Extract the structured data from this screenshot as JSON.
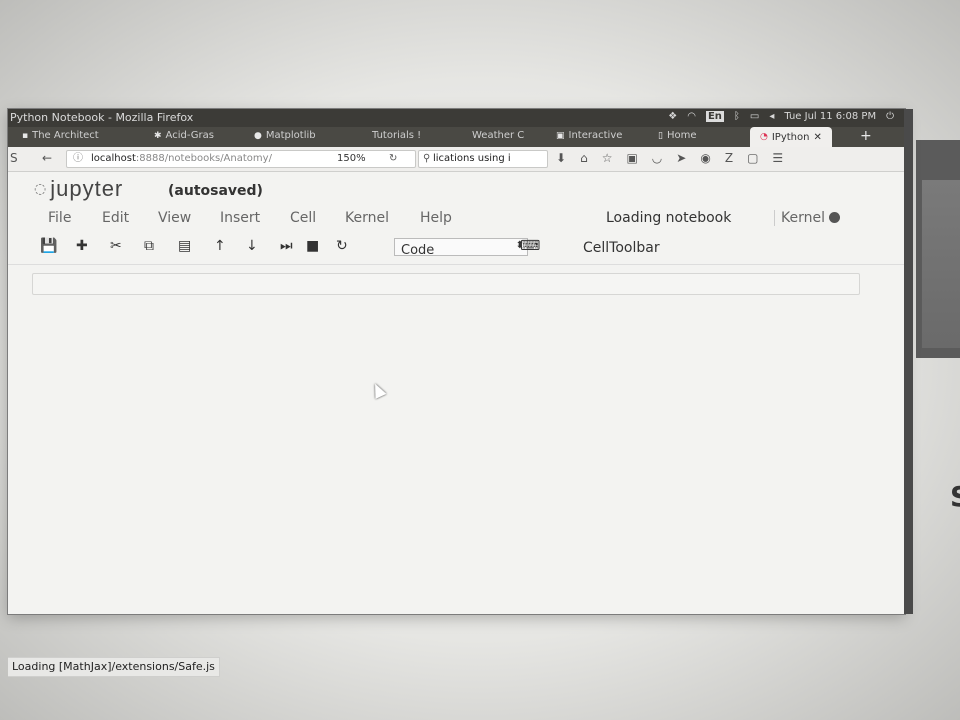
{
  "window": {
    "title": "Python Notebook - Mozilla Firefox"
  },
  "system_tray": {
    "keyboard_layout": "En",
    "clock": "Tue Jul 11 6:08 PM"
  },
  "tabs": [
    {
      "label": "The Architect",
      "icon": "page-icon"
    },
    {
      "label": "Acid-Gras",
      "icon": "star-icon"
    },
    {
      "label": "Matplotlib",
      "icon": "circle-icon"
    },
    {
      "label": "Tutorials !",
      "icon": "page-icon"
    },
    {
      "label": "Weather C",
      "icon": "page-icon"
    },
    {
      "label": "Interactive",
      "icon": "page-icon"
    },
    {
      "label": "Home",
      "icon": "page-icon"
    },
    {
      "label": "IPython",
      "icon": "python-icon",
      "active": true
    }
  ],
  "navbar": {
    "url_host": "localhost",
    "url_path": ":8888/notebooks/Anatomy/",
    "zoom": "150%",
    "search_value": "lications using i"
  },
  "jupyter": {
    "logo_text": "jupyter",
    "autosaved": "(autosaved)",
    "menu": [
      "File",
      "Edit",
      "View",
      "Insert",
      "Cell",
      "Kernel",
      "Help"
    ],
    "notification": "Loading notebook",
    "kernel_label": "Kernel",
    "cell_type": "Code",
    "celltoolbar_label": "CellToolbar"
  },
  "status": {
    "text": "Loading [MathJax]/extensions/Safe.js"
  }
}
